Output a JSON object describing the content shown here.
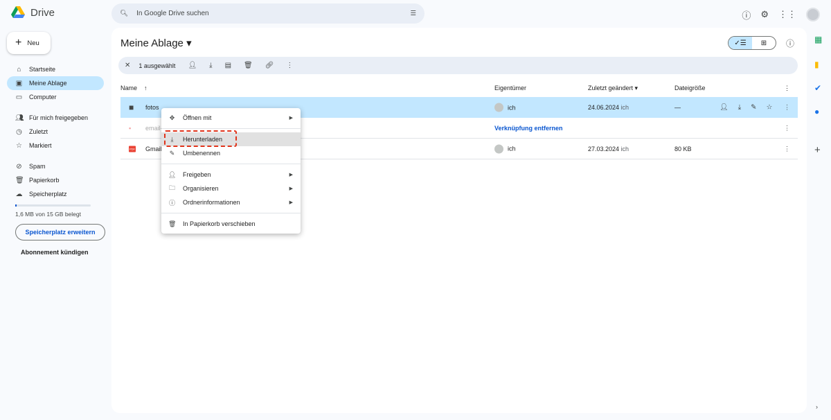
{
  "app": {
    "name": "Drive"
  },
  "search": {
    "placeholder": "In Google Drive suchen"
  },
  "sidebar": {
    "new_label": "Neu",
    "items": [
      {
        "label": "Startseite",
        "icon": "home-icon"
      },
      {
        "label": "Meine Ablage",
        "icon": "my-drive-icon",
        "active": true
      },
      {
        "label": "Computer",
        "icon": "computer-icon"
      },
      {
        "label": "Für mich freigegeben",
        "icon": "shared-icon"
      },
      {
        "label": "Zuletzt",
        "icon": "clock-icon"
      },
      {
        "label": "Markiert",
        "icon": "star-icon"
      },
      {
        "label": "Spam",
        "icon": "spam-icon"
      },
      {
        "label": "Papierkorb",
        "icon": "trash-icon"
      },
      {
        "label": "Speicherplatz",
        "icon": "cloud-icon"
      }
    ],
    "storage_text": "1,6 MB von 15 GB belegt",
    "storage_fraction": 0.0001,
    "extend_label": "Speicherplatz erweitern",
    "cancel_sub": "Abonnement kündigen"
  },
  "main": {
    "title": "Meine Ablage",
    "toolbar": {
      "selected": "1 ausgewählt"
    },
    "columns": {
      "name": "Name",
      "owner": "Eigentümer",
      "modified": "Zuletzt geändert",
      "size": "Dateigröße"
    },
    "rows": [
      {
        "name": "fotos",
        "owner": "ich",
        "date": "24.06.2024",
        "by": "ich",
        "size": "—",
        "selected": true
      },
      {
        "name": "email-",
        "link": "Verknüpfung entfernen"
      },
      {
        "name": "Gmail",
        "owner": "ich",
        "date": "27.03.2024",
        "by": "ich",
        "size": "80 KB",
        "badge": "PDF"
      }
    ]
  },
  "context_menu": {
    "items": [
      "Öffnen mit",
      "Herunterladen",
      "Umbenennen",
      "Freigeben",
      "Organisieren",
      "Ordnerinformationen",
      "In Papierkorb verschieben"
    ],
    "highlighted": "Herunterladen"
  },
  "colors": {
    "accent": "#0b57d0",
    "selected": "#c2e7ff",
    "highlight_dash": "#e0331a"
  }
}
